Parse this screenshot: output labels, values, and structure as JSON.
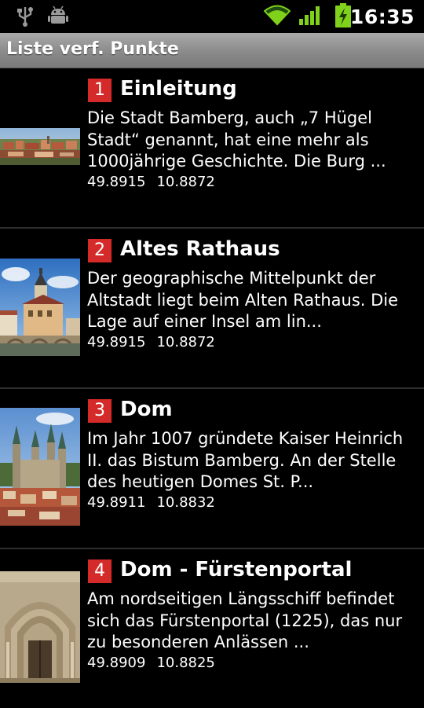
{
  "status_bar": {
    "time": "16:35",
    "icons": [
      "usb-icon",
      "android-debug-icon",
      "wifi-icon",
      "signal-icon",
      "battery-charging-icon"
    ]
  },
  "title_bar": {
    "title": "Liste verf. Punkte"
  },
  "items": [
    {
      "number": "1",
      "title": "Einleitung",
      "description": "Die Stadt Bamberg, auch „7 Hügel Stadt“ genannt, hat eine mehr als 1000jährige Geschichte. Die Burg ...",
      "lat": "49.8915",
      "lon": "10.8872",
      "image": "bamberg-panorama-image"
    },
    {
      "number": "2",
      "title": "Altes Rathaus",
      "description": "Der geographische Mittelpunkt der Altstadt liegt beim Alten Rathaus. Die Lage auf einer Insel am lin...",
      "lat": "49.8915",
      "lon": "10.8872",
      "image": "old-town-hall-image"
    },
    {
      "number": "3",
      "title": "Dom",
      "description": "Im Jahr 1007 gründete Kaiser Heinrich II. das Bistum Bamberg. An der Stelle des heutigen Domes St. P...",
      "lat": "49.8911",
      "lon": "10.8832",
      "image": "cathedral-image"
    },
    {
      "number": "4",
      "title": "Dom - Fürstenportal",
      "description": "Am nordseitigen Längsschiff  befindet sich das Fürstenportal (1225), das nur zu besonderen Anlässen ...",
      "lat": "49.8909",
      "lon": "10.8825",
      "image": "princes-portal-image"
    }
  ]
}
